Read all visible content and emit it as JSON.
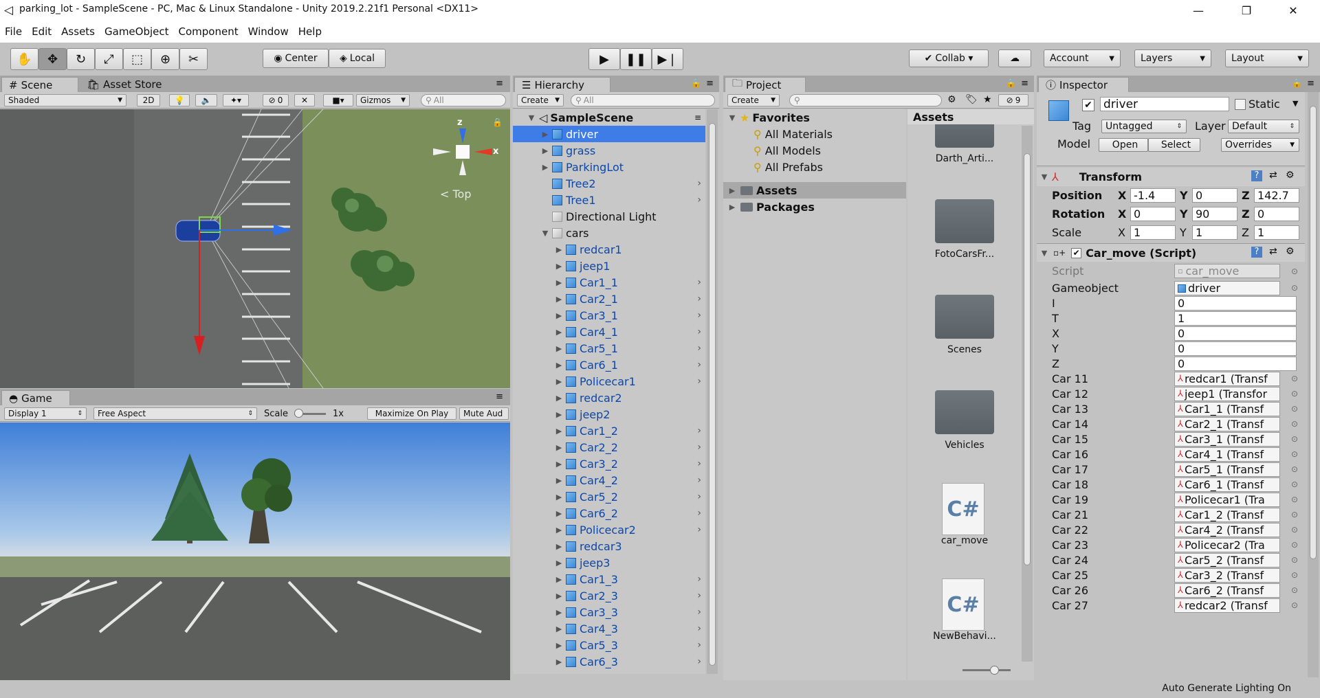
{
  "window": {
    "title": "parking_lot - SampleScene - PC, Mac & Linux Standalone - Unity 2019.2.21f1 Personal <DX11>",
    "minimize": "—",
    "maximize": "❐",
    "close": "✕"
  },
  "menu": [
    "File",
    "Edit",
    "Assets",
    "GameObject",
    "Component",
    "Window",
    "Help"
  ],
  "toolbar": {
    "pivot": "Center",
    "space": "Local",
    "collab": "Collab ▾",
    "account": "Account",
    "layers": "Layers",
    "layout": "Layout"
  },
  "scene": {
    "tab": "Scene",
    "tab2": "Asset Store",
    "shading": "Shaded",
    "mode2d": "2D",
    "hidden_count": "0",
    "gizmos": "Gizmos",
    "search": "All",
    "view_label": "Top",
    "axis_z": "z",
    "axis_x": "x"
  },
  "game": {
    "tab": "Game",
    "display": "Display 1",
    "aspect": "Free Aspect",
    "scale_label": "Scale",
    "scale_value": "1x",
    "maximize": "Maximize On Play",
    "mute": "Mute Aud"
  },
  "hierarchy": {
    "tab": "Hierarchy",
    "create": "Create",
    "search": "All",
    "scene": "SampleScene",
    "items": [
      {
        "label": "driver",
        "level": 1,
        "expand": true,
        "icon": "prefab",
        "selected": true,
        "chev": false
      },
      {
        "label": "grass",
        "level": 1,
        "expand": true,
        "icon": "prefab",
        "chev": false
      },
      {
        "label": "ParkingLot",
        "level": 1,
        "expand": true,
        "icon": "prefab",
        "chev": false
      },
      {
        "label": "Tree2",
        "level": 1,
        "expand": false,
        "icon": "prefab",
        "chev": true
      },
      {
        "label": "Tree1",
        "level": 1,
        "expand": false,
        "icon": "prefab",
        "chev": true
      },
      {
        "label": "Directional Light",
        "level": 1,
        "expand": false,
        "icon": "gray",
        "chev": false
      },
      {
        "label": "cars",
        "level": 1,
        "expand": true,
        "open": true,
        "icon": "gray",
        "chev": false
      },
      {
        "label": "redcar1",
        "level": 2,
        "expand": true,
        "icon": "prefab",
        "chev": false
      },
      {
        "label": "jeep1",
        "level": 2,
        "expand": true,
        "icon": "prefab",
        "chev": false
      },
      {
        "label": "Car1_1",
        "level": 2,
        "expand": true,
        "icon": "prefab",
        "chev": true
      },
      {
        "label": "Car2_1",
        "level": 2,
        "expand": true,
        "icon": "prefab",
        "chev": true
      },
      {
        "label": "Car3_1",
        "level": 2,
        "expand": true,
        "icon": "prefab",
        "chev": true
      },
      {
        "label": "Car4_1",
        "level": 2,
        "expand": true,
        "icon": "prefab",
        "chev": true
      },
      {
        "label": "Car5_1",
        "level": 2,
        "expand": true,
        "icon": "prefab",
        "chev": true
      },
      {
        "label": "Car6_1",
        "level": 2,
        "expand": true,
        "icon": "prefab",
        "chev": true
      },
      {
        "label": "Policecar1",
        "level": 2,
        "expand": true,
        "icon": "prefab",
        "chev": true
      },
      {
        "label": "redcar2",
        "level": 2,
        "expand": true,
        "icon": "prefab",
        "chev": false
      },
      {
        "label": "jeep2",
        "level": 2,
        "expand": true,
        "icon": "prefab",
        "chev": false
      },
      {
        "label": "Car1_2",
        "level": 2,
        "expand": true,
        "icon": "prefab",
        "chev": true
      },
      {
        "label": "Car2_2",
        "level": 2,
        "expand": true,
        "icon": "prefab",
        "chev": true
      },
      {
        "label": "Car3_2",
        "level": 2,
        "expand": true,
        "icon": "prefab",
        "chev": true
      },
      {
        "label": "Car4_2",
        "level": 2,
        "expand": true,
        "icon": "prefab",
        "chev": true
      },
      {
        "label": "Car5_2",
        "level": 2,
        "expand": true,
        "icon": "prefab",
        "chev": true
      },
      {
        "label": "Car6_2",
        "level": 2,
        "expand": true,
        "icon": "prefab",
        "chev": true
      },
      {
        "label": "Policecar2",
        "level": 2,
        "expand": true,
        "icon": "prefab",
        "chev": true
      },
      {
        "label": "redcar3",
        "level": 2,
        "expand": true,
        "icon": "prefab",
        "chev": false
      },
      {
        "label": "jeep3",
        "level": 2,
        "expand": true,
        "icon": "prefab",
        "chev": false
      },
      {
        "label": "Car1_3",
        "level": 2,
        "expand": true,
        "icon": "prefab",
        "chev": true
      },
      {
        "label": "Car2_3",
        "level": 2,
        "expand": true,
        "icon": "prefab",
        "chev": true
      },
      {
        "label": "Car3_3",
        "level": 2,
        "expand": true,
        "icon": "prefab",
        "chev": true
      },
      {
        "label": "Car4_3",
        "level": 2,
        "expand": true,
        "icon": "prefab",
        "chev": true
      },
      {
        "label": "Car5_3",
        "level": 2,
        "expand": true,
        "icon": "prefab",
        "chev": true
      },
      {
        "label": "Car6_3",
        "level": 2,
        "expand": true,
        "icon": "prefab",
        "chev": true
      }
    ]
  },
  "project": {
    "tab": "Project",
    "create": "Create",
    "count": "9",
    "favorites": "Favorites",
    "fav_items": [
      "All Materials",
      "All Models",
      "All Prefabs"
    ],
    "assets": "Assets",
    "packages": "Packages",
    "grid_header": "Assets",
    "grid": [
      {
        "label": "Darth_Arti...",
        "type": "folder"
      },
      {
        "label": "FotoCarsFr...",
        "type": "folder"
      },
      {
        "label": "Scenes",
        "type": "folder"
      },
      {
        "label": "Vehicles",
        "type": "folder"
      },
      {
        "label": "car_move",
        "type": "script"
      },
      {
        "label": "NewBehavi...",
        "type": "script"
      }
    ],
    "script_glyph": "C#"
  },
  "inspector": {
    "tab": "Inspector",
    "name": "driver",
    "static": "Static",
    "tag_label": "Tag",
    "tag": "Untagged",
    "layer_label": "Layer",
    "layer": "Default",
    "model_label": "Model",
    "open": "Open",
    "select": "Select",
    "overrides": "Overrides",
    "transform": {
      "title": "Transform",
      "position": {
        "label": "Position",
        "x": "-1.4",
        "y": "0",
        "z": "142.7"
      },
      "rotation": {
        "label": "Rotation",
        "x": "0",
        "y": "90",
        "z": "0"
      },
      "scale": {
        "label": "Scale",
        "x": "1",
        "y": "1",
        "z": "1"
      }
    },
    "carmove": {
      "title": "Car_move (Script)",
      "script_label": "Script",
      "script": "car_move",
      "fields": [
        {
          "label": "Gameobject",
          "value": "driver",
          "kind": "obj"
        },
        {
          "label": "I",
          "value": "0",
          "kind": "num"
        },
        {
          "label": "T",
          "value": "1",
          "kind": "num"
        },
        {
          "label": "X",
          "value": "0",
          "kind": "num"
        },
        {
          "label": "Y",
          "value": "0",
          "kind": "num"
        },
        {
          "label": "Z",
          "value": "0",
          "kind": "num"
        },
        {
          "label": "Car 11",
          "value": "redcar1 (Transf",
          "kind": "tr"
        },
        {
          "label": "Car 12",
          "value": "jeep1 (Transfor",
          "kind": "tr"
        },
        {
          "label": "Car 13",
          "value": "Car1_1 (Transf",
          "kind": "tr"
        },
        {
          "label": "Car 14",
          "value": "Car2_1 (Transf",
          "kind": "tr"
        },
        {
          "label": "Car 15",
          "value": "Car3_1 (Transf",
          "kind": "tr"
        },
        {
          "label": "Car 16",
          "value": "Car4_1 (Transf",
          "kind": "tr"
        },
        {
          "label": "Car 17",
          "value": "Car5_1 (Transf",
          "kind": "tr"
        },
        {
          "label": "Car 18",
          "value": "Car6_1 (Transf",
          "kind": "tr"
        },
        {
          "label": "Car 19",
          "value": "Policecar1 (Tra",
          "kind": "tr"
        },
        {
          "label": "Car 21",
          "value": "Car1_2 (Transf",
          "kind": "tr"
        },
        {
          "label": "Car 22",
          "value": "Car4_2 (Transf",
          "kind": "tr"
        },
        {
          "label": "Car 23",
          "value": "Policecar2 (Tra",
          "kind": "tr"
        },
        {
          "label": "Car 24",
          "value": "Car5_2 (Transf",
          "kind": "tr"
        },
        {
          "label": "Car 25",
          "value": "Car3_2 (Transf",
          "kind": "tr"
        },
        {
          "label": "Car 26",
          "value": "Car6_2 (Transf",
          "kind": "tr"
        },
        {
          "label": "Car 27",
          "value": "redcar2 (Transf",
          "kind": "tr"
        }
      ]
    }
  },
  "status": {
    "text": "Auto Generate Lighting On"
  },
  "colors": {
    "selection": "#3e7ce8",
    "prefab_text": "#0d47a8",
    "panel": "#c2c2c2"
  }
}
